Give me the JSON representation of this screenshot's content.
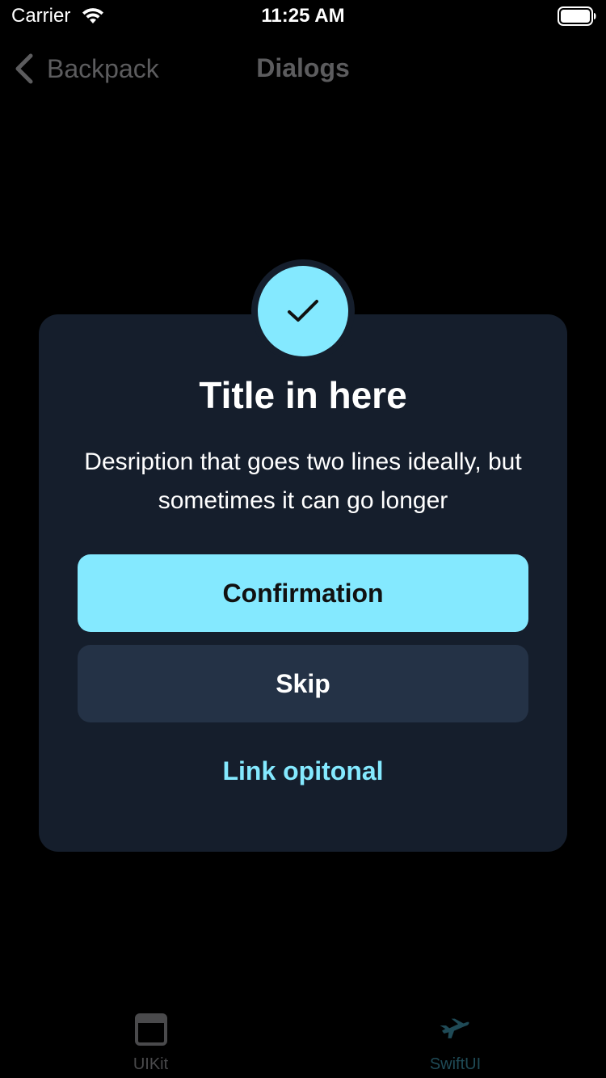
{
  "status_bar": {
    "carrier": "Carrier",
    "time": "11:25 AM"
  },
  "nav": {
    "back_label": "Backpack",
    "title": "Dialogs"
  },
  "dialog": {
    "icon": "checkmark-icon",
    "title": "Title in here",
    "description": "Desription that goes two lines ideally, but sometimes it can go longer",
    "confirm_label": "Confirmation",
    "skip_label": "Skip",
    "link_label": "Link opitonal"
  },
  "tabs": [
    {
      "label": "UIKit",
      "icon": "window-icon"
    },
    {
      "label": "SwiftUI",
      "icon": "airplane-icon"
    }
  ],
  "colors": {
    "background": "#000000",
    "dialog_bg": "#151e2c",
    "accent": "#84e9ff",
    "secondary_button": "#243246",
    "nav_dimmed_text": "#5c5c5e"
  }
}
